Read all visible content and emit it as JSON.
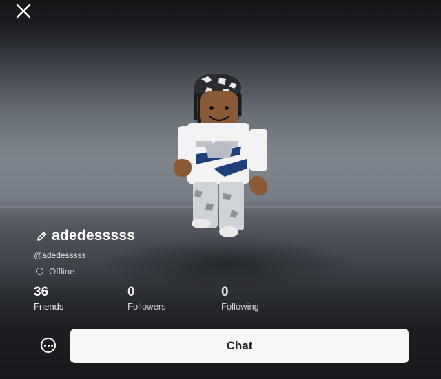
{
  "profile": {
    "display_name": "adedesssss",
    "username": "@adedesssss",
    "status": "Offline"
  },
  "stats": [
    {
      "value": "36",
      "label": "Friends"
    },
    {
      "value": "0",
      "label": "Followers"
    },
    {
      "value": "0",
      "label": "Following"
    }
  ],
  "actions": {
    "chat_label": "Chat"
  },
  "icons": {
    "close": "close-icon",
    "edit": "pencil-icon",
    "status": "offline-status-icon",
    "more": "more-options-icon"
  },
  "colors": {
    "chat_button_bg": "#f7f7f8",
    "chat_button_text": "#222222"
  }
}
